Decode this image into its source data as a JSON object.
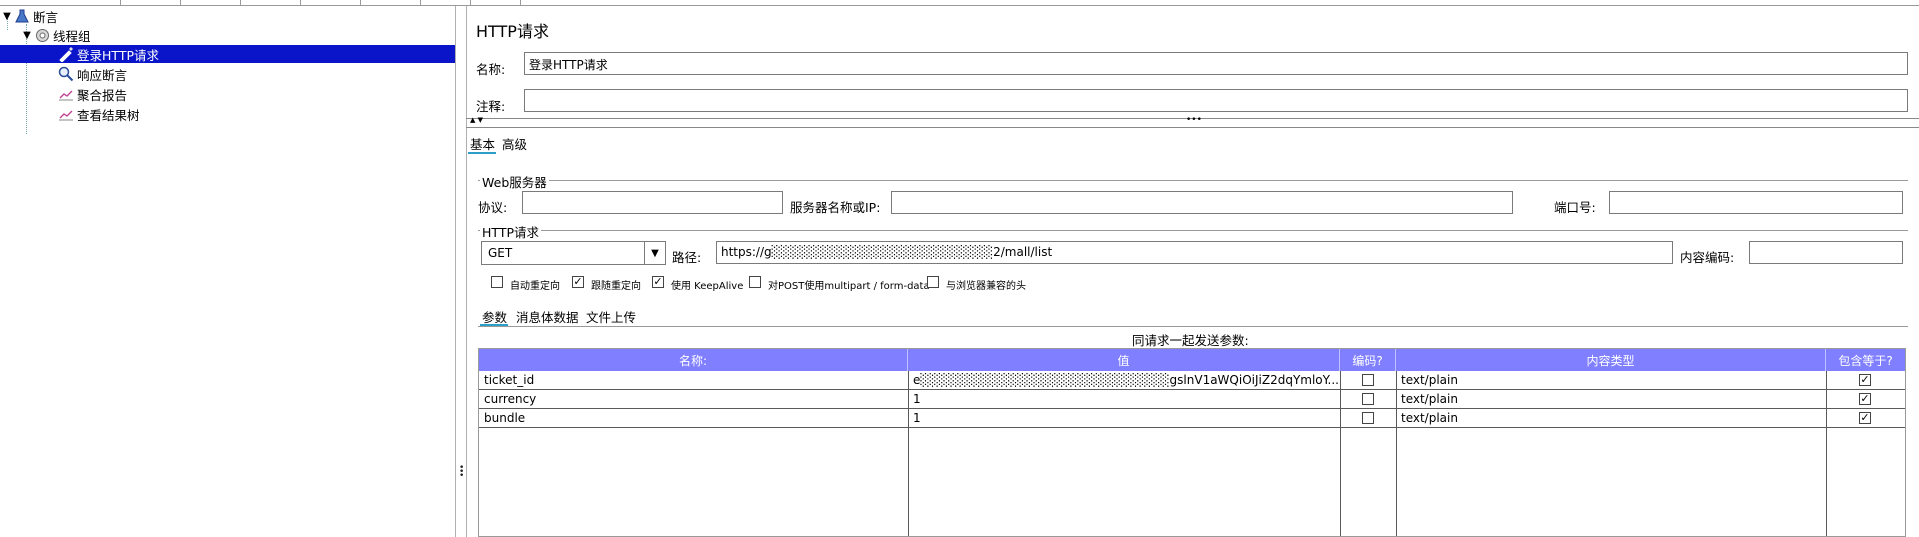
{
  "tree": {
    "items": [
      {
        "label": "断言",
        "icon": "flask-icon"
      },
      {
        "label": "线程组",
        "icon": "gear-icon"
      },
      {
        "label": "登录HTTP请求",
        "icon": "pipette-icon"
      },
      {
        "label": "响应断言",
        "icon": "magnifier-icon"
      },
      {
        "label": "聚合报告",
        "icon": "chart-icon"
      },
      {
        "label": "查看结果树",
        "icon": "chart-icon"
      }
    ],
    "selected_color": "#0a14c8"
  },
  "panel": {
    "title": "HTTP请求",
    "name_label": "名称:",
    "name_value": "登录HTTP请求",
    "comment_label": "注释:",
    "comment_value": "",
    "tabs": [
      "基本",
      "高级"
    ],
    "web_server": {
      "group_label": "Web服务器",
      "protocol_label": "协议:",
      "protocol_value": "",
      "server_label": "服务器名称或IP:",
      "server_value": "",
      "port_label": "端口号:",
      "port_value": ""
    },
    "http_request": {
      "group_label": "HTTP请求",
      "method": "GET",
      "path_label": "路径:",
      "path_value": "https://g░░░░░░░░░░░░░░░░░░░░░░░░2/mall/list",
      "encoding_label": "内容编码:",
      "encoding_value": ""
    },
    "options": [
      {
        "label": "自动重定向",
        "checked": false
      },
      {
        "label": "跟随重定向",
        "checked": true
      },
      {
        "label": "使用 KeepAlive",
        "checked": true
      },
      {
        "label": "对POST使用multipart / form-data",
        "checked": false
      },
      {
        "label": "与浏览器兼容的头",
        "checked": false
      }
    ],
    "sub_tabs": [
      "参数",
      "消息体数据",
      "文件上传"
    ],
    "params_caption": "同请求一起发送参数:",
    "table": {
      "headers": [
        "名称:",
        "值",
        "编码?",
        "内容类型",
        "包含等于?"
      ],
      "rows": [
        {
          "name": "ticket_id",
          "value": "e░░░░░░░░░░░░░░░░░░░░░░░░░░░gslnV1aWQiOiJiZ2dqYmloY...",
          "encode": false,
          "content_type": "text/plain",
          "include_equals": true
        },
        {
          "name": "currency",
          "value": "1",
          "encode": false,
          "content_type": "text/plain",
          "include_equals": true
        },
        {
          "name": "bundle",
          "value": "1",
          "encode": false,
          "content_type": "text/plain",
          "include_equals": true
        }
      ],
      "header_color": "#7f7fff"
    }
  }
}
